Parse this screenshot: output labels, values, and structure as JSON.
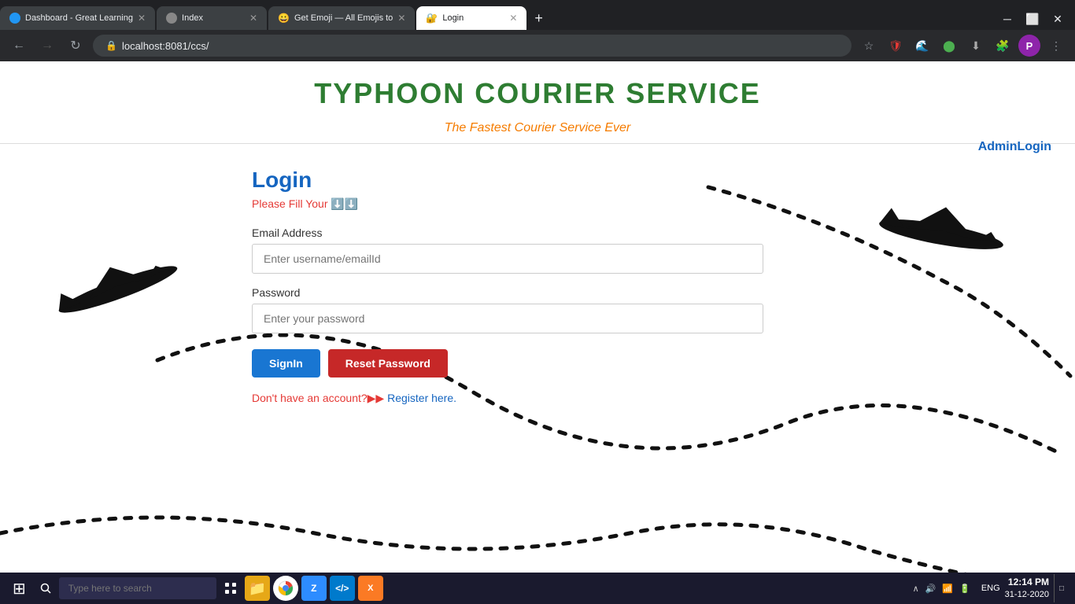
{
  "browser": {
    "tabs": [
      {
        "id": "tab1",
        "title": "Dashboard - Great Learning",
        "icon_color": "blue",
        "active": false,
        "favicon": "G"
      },
      {
        "id": "tab2",
        "title": "Index",
        "icon_color": "grey",
        "active": false,
        "favicon": "I"
      },
      {
        "id": "tab3",
        "title": "Get Emoji — All Emojis to",
        "icon_color": "orange",
        "active": false,
        "favicon": "😀"
      },
      {
        "id": "tab4",
        "title": "Login",
        "icon_color": "orange",
        "active": true,
        "favicon": "🔐"
      }
    ],
    "new_tab_label": "+",
    "address": "localhost:8081/ccs/",
    "nav_back": "←",
    "nav_forward": "→",
    "nav_refresh": "↻"
  },
  "page": {
    "site_title": "TYPHOON COURIER SERVICE",
    "site_subtitle": "The Fastest Courier Service Ever",
    "admin_login_label": "AdminLogin",
    "login": {
      "title": "Login",
      "fill_notice": "Please Fill Your ⬇️⬇️",
      "email_label": "Email Address",
      "email_placeholder": "Enter username/emailId",
      "password_label": "Password",
      "password_placeholder": "Enter your password",
      "signin_label": "SignIn",
      "reset_label": "Reset Password",
      "register_prompt": "Don't have an account?▶▶",
      "register_link": "Register here."
    }
  },
  "taskbar": {
    "search_placeholder": "Type here to search",
    "clock_time": "12:14 PM",
    "clock_date": "31-12-2020",
    "language": "ENG"
  }
}
